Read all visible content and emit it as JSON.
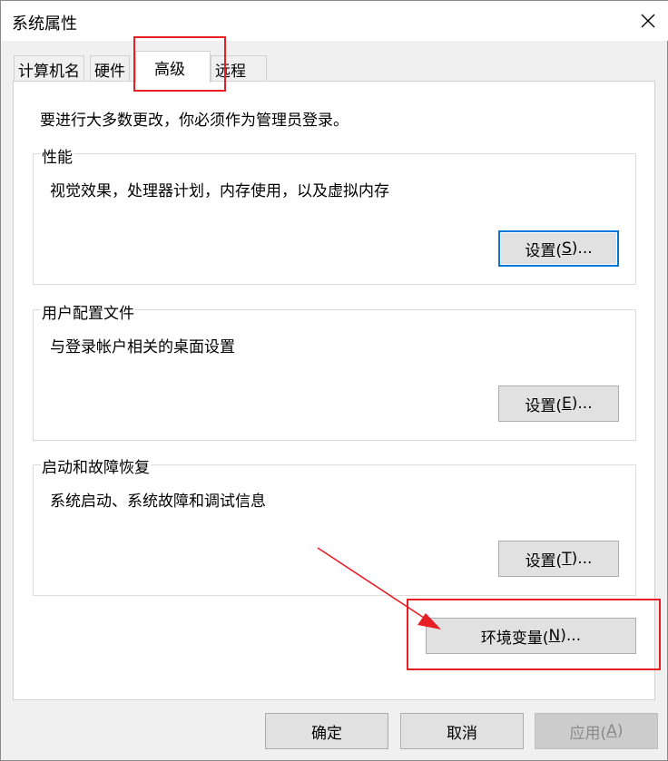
{
  "window": {
    "title": "系统属性"
  },
  "tabs": [
    {
      "label": "计算机名"
    },
    {
      "label": "硬件"
    },
    {
      "label": "高级"
    },
    {
      "label": "远程"
    }
  ],
  "admin_note": "要进行大多数更改，你必须作为管理员登录。",
  "performance": {
    "title": "性能",
    "description": "视觉效果，处理器计划，内存使用，以及虚拟内存",
    "button_prefix": "设置(",
    "button_key": "S",
    "button_suffix": ")..."
  },
  "user_profiles": {
    "title": "用户配置文件",
    "description": "与登录帐户相关的桌面设置",
    "button_prefix": "设置(",
    "button_key": "E",
    "button_suffix": ")..."
  },
  "startup_recovery": {
    "title": "启动和故障恢复",
    "description": "系统启动、系统故障和调试信息",
    "button_prefix": "设置(",
    "button_key": "T",
    "button_suffix": ")..."
  },
  "env_vars_button": {
    "prefix": "环境变量(",
    "key": "N",
    "suffix": ")..."
  },
  "footer": {
    "ok": "确定",
    "cancel": "取消",
    "apply_prefix": "应用(",
    "apply_key": "A",
    "apply_suffix": ")"
  },
  "colors": {
    "annotation": "#e81e25",
    "focus": "#0078d7"
  }
}
